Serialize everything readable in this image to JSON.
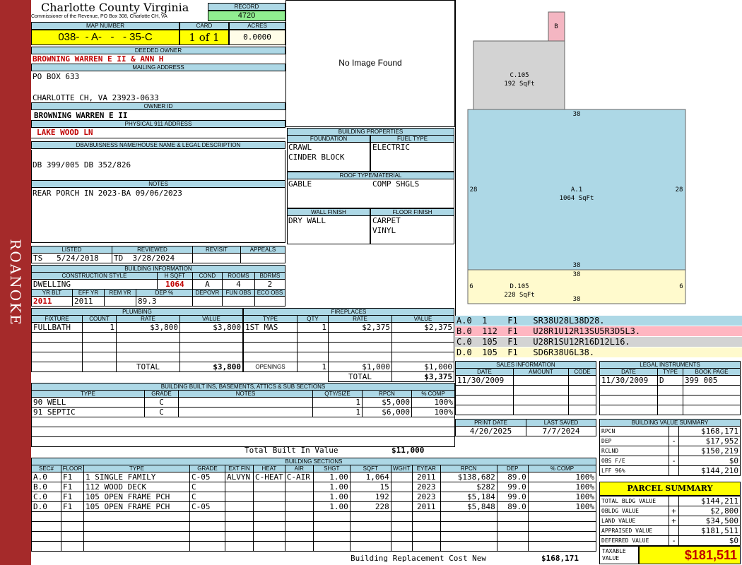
{
  "side_label": "ROANOKE",
  "county": {
    "title": "Charlotte County Virginia",
    "subtitle": "Commissioner of the Revenue, PO Box 308, Charlotte CH, VA"
  },
  "record": {
    "label": "RECORD",
    "value": "4720"
  },
  "map": {
    "label": "MAP NUMBER",
    "value": "038-  - A-   -   - 35-C"
  },
  "card": {
    "label": "CARD",
    "value": "1 of 1"
  },
  "acres": {
    "label": "ACRES",
    "value": "0.0000"
  },
  "owner": {
    "label": "DEEDED OWNER",
    "value": "BROWNING WARREN E II & ANN H"
  },
  "mailing": {
    "label": "MAILING ADDRESS",
    "line1": "PO BOX 633",
    "line2": "CHARLOTTE CH, VA 23923-0633"
  },
  "owner_id": {
    "label": "OWNER ID",
    "value": "BROWNING WARREN E II"
  },
  "physical": {
    "label": "PHYSICAL 911 ADDRESS",
    "value": "LAKE WOOD LN"
  },
  "dba": {
    "label": "DBA/BUISNESS NAME/HOUSE NAME & LEGAL DESCRIPTION",
    "value": "DB 399/005 DB 352/826"
  },
  "notes": {
    "label": "NOTES",
    "value": "REAR PORCH IN 2023-BA 09/06/2023"
  },
  "photo": {
    "text": "No Image Found"
  },
  "bldg_props": {
    "label": "BUILDING PROPERTIES",
    "foundation_label": "FOUNDATION",
    "foundation1": "CRAWL",
    "foundation2": "CINDER BLOCK",
    "fuel_label": "FUEL TYPE",
    "fuel": "ELECTRIC",
    "roof_label": "ROOF TYPE/MATERIAL",
    "roof1": "GABLE",
    "roof2": "COMP SHGLS",
    "wall_label": "WALL FINISH",
    "wall": "DRY WALL",
    "floor_label": "FLOOR FINISH",
    "floor1": "CARPET",
    "floor2": "VINYL"
  },
  "listed": {
    "listed_label": "LISTED",
    "reviewed_label": "REVIEWED",
    "revisit_label": "REVISIT",
    "appeals_label": "APPEALS",
    "listed_by": "TS",
    "listed_date": "5/24/2018",
    "reviewed_by": "TD",
    "reviewed_date": "3/28/2024"
  },
  "bldg_info": {
    "label": "BUILDING INFORMATION",
    "h": [
      "CONSTRUCTION STYLE",
      "H SQFT",
      "COND",
      "ROOMS",
      "BDRMS"
    ],
    "style": "DWELLING",
    "hsqft": "1064",
    "cond": "A",
    "rooms": "4",
    "bdrms": "2",
    "h2": [
      "YR BLT",
      "EFF YR",
      "REM YR",
      "DEP %",
      "DEPOVR",
      "FUN OBS",
      "ECO OBS"
    ],
    "yr_blt": "2011",
    "eff_yr": "2011",
    "dep": "89.3"
  },
  "plumbing": {
    "label": "PLUMBING",
    "h": [
      "FIXTURE",
      "COUNT",
      "RATE",
      "VALUE"
    ],
    "rows": [
      [
        "FULLBATH",
        "1",
        "$3,800",
        "$3,800"
      ]
    ],
    "total_label": "TOTAL",
    "total": "$3,800"
  },
  "fireplaces": {
    "label": "FIREPLACES",
    "h": [
      "TYPE",
      "QTY",
      "RATE",
      "VALUE"
    ],
    "rows": [
      [
        "1ST MAS",
        "1",
        "$2,375",
        "$2,375"
      ]
    ],
    "openings_label": "OPENINGS",
    "openings": [
      "1",
      "$1,000",
      "$1,000"
    ],
    "total_label": "TOTAL",
    "total": "$3,375"
  },
  "builtins": {
    "label": "BUILDING BUILT INS, BASEMENTS, ATTICS & SUB SECTIONS",
    "h": [
      "TYPE",
      "GRADE",
      "NOTES",
      "QTY/SIZE",
      "RPCN",
      "% COMP"
    ],
    "rows": [
      [
        "90 WELL",
        "C",
        "",
        "1",
        "$5,000",
        "100%"
      ],
      [
        "91 SEPTIC",
        "C",
        "",
        "1",
        "$6,000",
        "100%"
      ]
    ],
    "total_label": "Total Built In Value",
    "total": "$11,000"
  },
  "sections": {
    "label": "BUILDING SECTIONS",
    "h": [
      "SEC#",
      "FLOOR",
      "TYPE",
      "GRADE",
      "EXT FIN",
      "HEAT",
      "AIR",
      "SHGT",
      "SQFT",
      "WGHT",
      "EYEAR",
      "RPCN",
      "DEP",
      "% COMP"
    ],
    "rows": [
      [
        "A.0",
        "F1",
        "1 SINGLE FAMILY",
        "C-05",
        "ALVYN",
        "C-HEAT",
        "C-AIR",
        "1.00",
        "1,064",
        "",
        "2011",
        "$138,682",
        "89.0",
        "100%"
      ],
      [
        "B.0",
        "F1",
        "112 WOOD DECK",
        "C",
        "",
        "",
        "",
        "1.00",
        "15",
        "",
        "2023",
        "$282",
        "99.0",
        "100%"
      ],
      [
        "C.0",
        "F1",
        "105 OPEN FRAME PCH",
        "C",
        "",
        "",
        "",
        "1.00",
        "192",
        "",
        "2023",
        "$5,184",
        "99.0",
        "100%"
      ],
      [
        "D.0",
        "F1",
        "105 OPEN FRAME PCH",
        "C-05",
        "",
        "",
        "",
        "1.00",
        "228",
        "",
        "2011",
        "$5,848",
        "89.0",
        "100%"
      ]
    ],
    "total_label": "Building Replacement Cost New",
    "total": "$168,171"
  },
  "sketch": {
    "b_label": "B",
    "c_label": "C.105",
    "c_area": "192 SqFt",
    "a_label": "A.1",
    "a_area": "1064 SqFt",
    "d_label": "D.105",
    "d_area": "228 SqFt",
    "dim_38": "38",
    "dim_28": "28",
    "dim_6": "6",
    "colors": {
      "b": "#f4b6c2",
      "c": "#d3d3d3",
      "a": "#add8e6",
      "d": "#fffacd"
    },
    "legend": [
      {
        "text": "A.0  1    F1   SR38U28L38D28.",
        "color": "#add8e6"
      },
      {
        "text": "B.0  112  F1   U28R1U12R13SU5R3D5L3.",
        "color": "#ffb6c1"
      },
      {
        "text": "C.0  105  F1   U28R1SU12R16D12L16.",
        "color": "#d3d3d3"
      },
      {
        "text": "D.0  105  F1   SD6R38U6L38.",
        "color": "#fffacd"
      }
    ]
  },
  "sales": {
    "label": "SALES INFORMATION",
    "h": [
      "DATE",
      "AMOUNT",
      "CODE"
    ],
    "date": "11/30/2009"
  },
  "legal": {
    "label": "LEGAL INSTRUMENTS",
    "h": [
      "DATE",
      "TYPE",
      "BOOK PAGE"
    ],
    "date": "11/30/2009",
    "type": "D",
    "book": "399 005"
  },
  "print": {
    "print_label": "PRINT DATE",
    "saved_label": "LAST SAVED",
    "print_date": "4/20/2025",
    "saved": "7/7/2024"
  },
  "bvs": {
    "label": "BUILDING VALUE SUMMARY",
    "rows": [
      [
        "RPCN",
        "",
        "$168,171"
      ],
      [
        "DEP",
        "-",
        "$17,952"
      ],
      [
        "RCLND",
        "",
        "$150,219"
      ],
      [
        "OBS F/E",
        "-",
        "$0"
      ],
      [
        "LFF      96%",
        "",
        "$144,210"
      ]
    ]
  },
  "parcel": {
    "label": "PARCEL SUMMARY",
    "rows": [
      [
        "TOTAL BLDG VALUE",
        "",
        "$144,211"
      ],
      [
        "OBLDG VALUE",
        "+",
        "$2,800"
      ],
      [
        "LAND VALUE",
        "+",
        "$34,500"
      ],
      [
        "APPRAISED VALUE",
        "",
        "$181,511"
      ],
      [
        "DEFERRED VALUE",
        "-",
        "$0"
      ]
    ],
    "taxable_label1": "TAXABLE",
    "taxable_label2": "VALUE",
    "taxable": "$181,511"
  }
}
